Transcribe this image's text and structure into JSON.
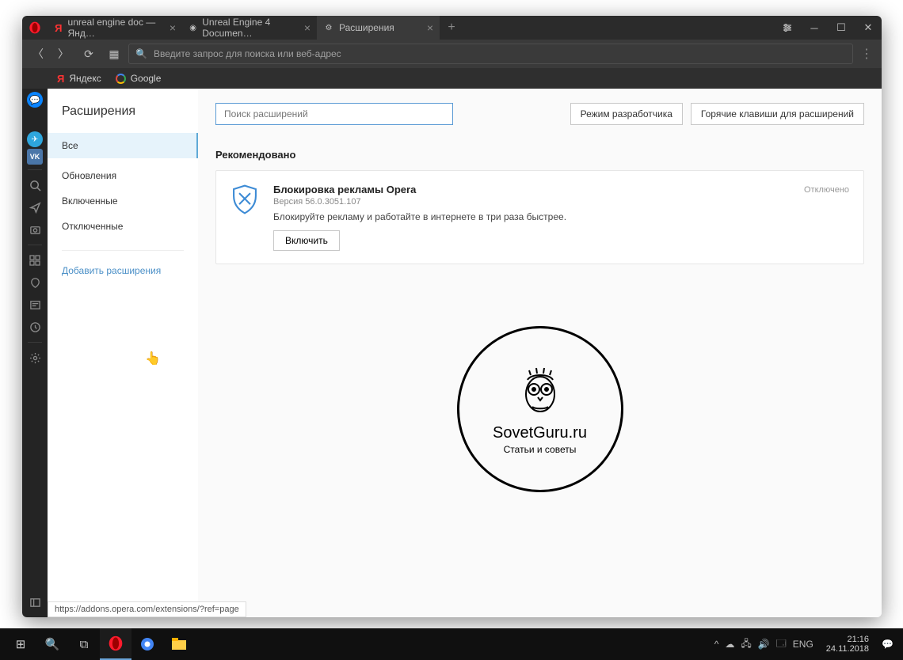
{
  "tabs": [
    {
      "label": "unreal engine doc — Янд…",
      "icon": "Я",
      "iconColor": "#ff3333"
    },
    {
      "label": "Unreal Engine 4 Documen…",
      "icon": "◉",
      "iconColor": "#777"
    },
    {
      "label": "Расширения",
      "icon": "⚙",
      "iconColor": "#bbb",
      "active": true
    }
  ],
  "address": {
    "placeholder": "Введите запрос для поиска или веб-адрес"
  },
  "speed": {
    "yandex": "Яндекс",
    "google": "Google"
  },
  "ext": {
    "title": "Расширения",
    "items": [
      "Все",
      "Обновления",
      "Включенные",
      "Отключенные"
    ],
    "selected": 0,
    "add": "Добавить расширения",
    "search_ph": "Поиск расширений",
    "devmode": "Режим разработчика",
    "hotkeys": "Горячие клавиши для расширений",
    "section": "Рекомендовано",
    "card": {
      "title": "Блокировка рекламы Opera",
      "version": "Версия 56.0.3051.107",
      "desc": "Блокируйте рекламу и работайте в интернете в три раза быстрее.",
      "enable": "Включить",
      "status": "Отключено"
    }
  },
  "watermark": {
    "site": "SovetGuru.ru",
    "sub": "Статьи и советы"
  },
  "statusbar": "https://addons.opera.com/extensions/?ref=page",
  "tray": {
    "lang": "ENG",
    "time": "21:16",
    "date": "24.11.2018"
  }
}
